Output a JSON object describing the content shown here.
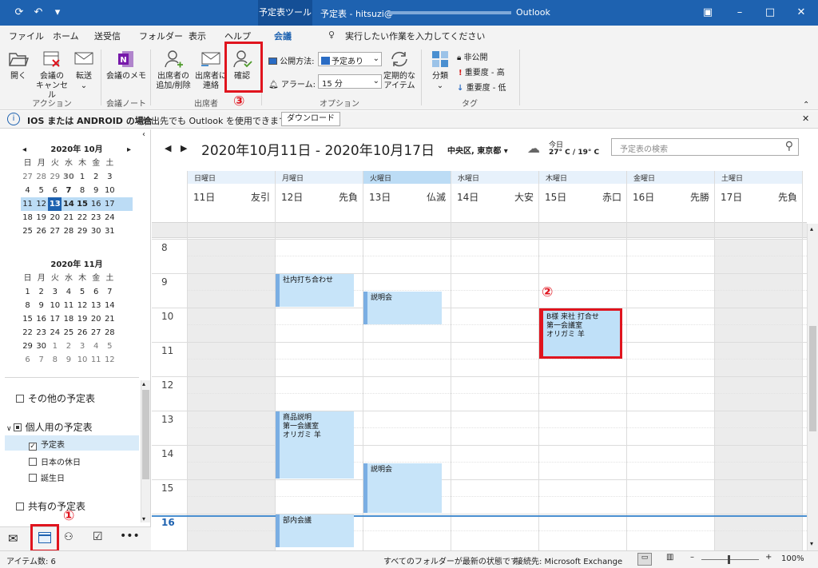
{
  "titlebar": {
    "context_tab": "予定表ツール",
    "title": "予定表 - hitsuzi@",
    "app": "Outlook"
  },
  "menu": {
    "items": [
      "ファイル",
      "ホーム",
      "送受信",
      "フォルダー",
      "表示",
      "ヘルプ",
      "会議"
    ],
    "search_prompt": "実行したい作業を入力してください"
  },
  "ribbon": {
    "open": "開く",
    "cancel_l1": "会議の",
    "cancel_l2": "キャンセル",
    "forward": "転送",
    "onenote": "会議のメモ",
    "add_att_l1": "出席者の",
    "add_att_l2": "追加/削除",
    "contact_l1": "出席者に",
    "contact_l2": "連絡",
    "confirm": "確認",
    "show_as_label": "公開方法:",
    "show_as_value": "予定あり",
    "reminder_label": "アラーム:",
    "reminder_value": "15 分",
    "recur_l1": "定期的な",
    "recur_l2": "アイテム",
    "categorize": "分類",
    "private": "非公開",
    "high": "重要度 - 高",
    "low": "重要度 - 低",
    "groups": {
      "action": "アクション",
      "notes": "会議ノート",
      "attendees": "出席者",
      "options": "オプション",
      "tags": "タグ"
    },
    "markers": {
      "m1": "①",
      "m2": "②",
      "m3": "③"
    }
  },
  "infobar": {
    "bold": "IOS または ANDROID の場合",
    "text": "外出先でも Outlook を使用できます。",
    "button": "ダウンロード"
  },
  "cal1": {
    "title": "2020年 10月",
    "weekdays": [
      "日",
      "月",
      "火",
      "水",
      "木",
      "金",
      "土"
    ],
    "rows": [
      [
        "27",
        "28",
        "29",
        "30",
        "1",
        "2",
        "3"
      ],
      [
        "4",
        "5",
        "6",
        "7",
        "8",
        "9",
        "10"
      ],
      [
        "11",
        "12",
        "13",
        "14",
        "15",
        "16",
        "17"
      ],
      [
        "18",
        "19",
        "20",
        "21",
        "22",
        "23",
        "24"
      ],
      [
        "25",
        "26",
        "27",
        "28",
        "29",
        "30",
        "31"
      ]
    ]
  },
  "cal2": {
    "title": "2020年 11月",
    "weekdays": [
      "日",
      "月",
      "火",
      "水",
      "木",
      "金",
      "土"
    ],
    "rows": [
      [
        "1",
        "2",
        "3",
        "4",
        "5",
        "6",
        "7"
      ],
      [
        "8",
        "9",
        "10",
        "11",
        "12",
        "13",
        "14"
      ],
      [
        "15",
        "16",
        "17",
        "18",
        "19",
        "20",
        "21"
      ],
      [
        "22",
        "23",
        "24",
        "25",
        "26",
        "27",
        "28"
      ],
      [
        "29",
        "30",
        "1",
        "2",
        "3",
        "4",
        "5"
      ],
      [
        "6",
        "7",
        "8",
        "9",
        "10",
        "11",
        "12"
      ]
    ]
  },
  "folders": {
    "other": "その他の予定表",
    "personal": "個人用の予定表",
    "calendar": "予定表",
    "holidays": "日本の休日",
    "birthdays": "誕生日",
    "shared": "共有の予定表"
  },
  "calendar": {
    "range": "2020年10月11日 - 2020年10月17日",
    "location": "中央区, 東京都",
    "weather_label": "今日",
    "weather_temp": "27° C / 19° C",
    "search_placeholder": "予定表の検索",
    "days": [
      {
        "name": "日曜日",
        "date": "11日",
        "rokuyo": "友引"
      },
      {
        "name": "月曜日",
        "date": "12日",
        "rokuyo": "先負"
      },
      {
        "name": "火曜日",
        "date": "13日",
        "rokuyo": "仏滅"
      },
      {
        "name": "水曜日",
        "date": "14日",
        "rokuyo": "大安"
      },
      {
        "name": "木曜日",
        "date": "15日",
        "rokuyo": "赤口"
      },
      {
        "name": "金曜日",
        "date": "16日",
        "rokuyo": "先勝"
      },
      {
        "name": "土曜日",
        "date": "17日",
        "rokuyo": "先負"
      }
    ],
    "hours": [
      "8",
      "9",
      "10",
      "11",
      "12",
      "13",
      "14",
      "15",
      "16"
    ],
    "appointments": [
      {
        "l1": "社内打ち合わせ",
        "l2": "",
        "l3": ""
      },
      {
        "l1": "説明会",
        "l2": "",
        "l3": ""
      },
      {
        "l1": "B様 来社 打合せ",
        "l2": "第一会議室",
        "l3": "オリガミ 羊"
      },
      {
        "l1": "商品説明",
        "l2": "第一会議室",
        "l3": "オリガミ 羊"
      },
      {
        "l1": "説明会",
        "l2": "",
        "l3": ""
      },
      {
        "l1": "部内会議",
        "l2": "",
        "l3": ""
      }
    ]
  },
  "status": {
    "items": "アイテム数: 6",
    "sync": "すべてのフォルダーが最新の状態です。",
    "connection": "接続先: Microsoft Exchange",
    "zoom": "100%"
  }
}
